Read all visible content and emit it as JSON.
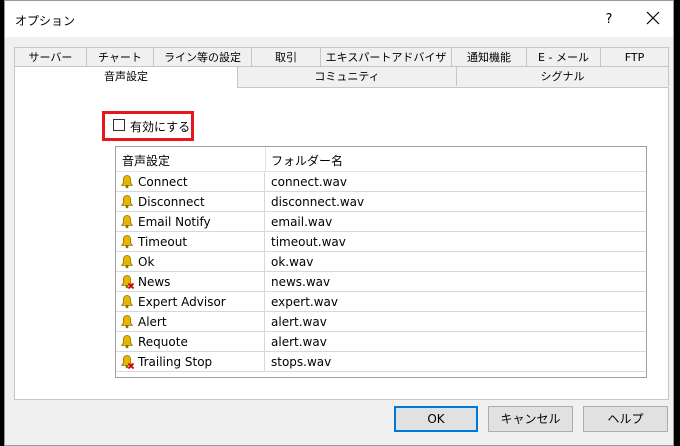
{
  "window": {
    "title": "オプション",
    "help_label": "?"
  },
  "tabs_row1": [
    "サーバー",
    "チャート",
    "ライン等の設定",
    "取引",
    "エキスパートアドバイザ",
    "通知機能",
    "E - メール",
    "FTP"
  ],
  "tabs_row2": [
    "音声設定",
    "コミュニティ",
    "シグナル"
  ],
  "active_tab": "音声設定",
  "enable": {
    "label": "有効にする",
    "checked": false
  },
  "sound_list": {
    "columns": [
      "音声設定",
      "フォルダー名"
    ],
    "rows": [
      {
        "event": "Connect",
        "file": "connect.wav",
        "icon": "bell-icon"
      },
      {
        "event": "Disconnect",
        "file": "disconnect.wav",
        "icon": "bell-icon"
      },
      {
        "event": "Email Notify",
        "file": "email.wav",
        "icon": "bell-icon"
      },
      {
        "event": "Timeout",
        "file": "timeout.wav",
        "icon": "bell-icon"
      },
      {
        "event": "Ok",
        "file": "ok.wav",
        "icon": "bell-icon"
      },
      {
        "event": "News",
        "file": "news.wav",
        "icon": "bell-disabled-icon"
      },
      {
        "event": "Expert Advisor",
        "file": "expert.wav",
        "icon": "bell-icon"
      },
      {
        "event": "Alert",
        "file": "alert.wav",
        "icon": "bell-icon"
      },
      {
        "event": "Requote",
        "file": "alert.wav",
        "icon": "bell-icon"
      },
      {
        "event": "Trailing Stop",
        "file": "stops.wav",
        "icon": "bell-disabled-icon"
      }
    ]
  },
  "buttons": {
    "ok": "OK",
    "cancel": "キャンセル",
    "help": "ヘルプ"
  },
  "colors": {
    "highlight": "#e8151a",
    "primary_border": "#0078d7",
    "bell": "#e8b400"
  }
}
